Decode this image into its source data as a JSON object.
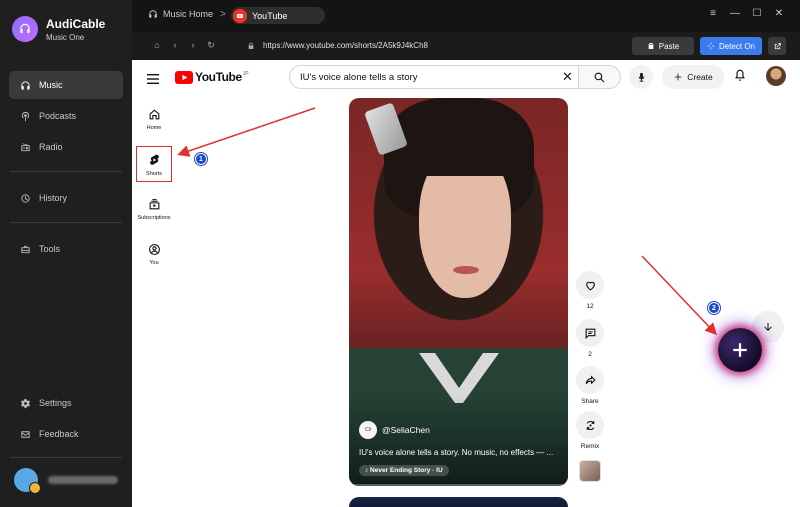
{
  "app": {
    "name": "AudiCable",
    "subtitle": "Music One"
  },
  "sidebar": {
    "items": [
      {
        "label": "Music",
        "icon": "headphones-icon",
        "active": true
      },
      {
        "label": "Podcasts",
        "icon": "podcast-icon",
        "active": false
      },
      {
        "label": "Radio",
        "icon": "radio-icon",
        "active": false
      },
      {
        "label": "History",
        "icon": "history-icon",
        "active": false
      },
      {
        "label": "Tools",
        "icon": "toolbox-icon",
        "active": false
      },
      {
        "label": "Settings",
        "icon": "gear-icon",
        "active": false
      },
      {
        "label": "Feedback",
        "icon": "mail-icon",
        "active": false
      }
    ]
  },
  "topbar": {
    "home_label": "Music Home",
    "separator": ">",
    "tab_label": "YouTube",
    "window_buttons": [
      "≡",
      "—",
      "☐",
      "✕"
    ]
  },
  "addressbar": {
    "url": "https://www.youtube.com/shorts/2A5k9J4kCh8",
    "paste_label": "Paste",
    "detect_label": "Detect On"
  },
  "youtube": {
    "logo_text": "YouTube",
    "search_value": "IU's voice alone tells a story",
    "create_label": "Create",
    "guide": [
      {
        "label": "Home",
        "icon": "home-icon"
      },
      {
        "label": "Shorts",
        "icon": "shorts-icon"
      },
      {
        "label": "Subscriptions",
        "icon": "subscriptions-icon"
      },
      {
        "label": "You",
        "icon": "user-icon"
      }
    ],
    "short": {
      "channel": "@SeliaChen",
      "channel_avatar_text": "Cli",
      "caption": "IU's voice alone tells a story. No music, no effects — ...",
      "sound": "♪ Never Ending Story · IU",
      "progress": 0.02
    },
    "actions": [
      {
        "label": "12",
        "icon": "like-icon"
      },
      {
        "label": "2",
        "icon": "comment-icon"
      },
      {
        "label": "Share",
        "icon": "share-icon"
      },
      {
        "label": "Remix",
        "icon": "remix-icon"
      }
    ]
  },
  "annotations": {
    "badge_1": "1",
    "badge_2": "2"
  },
  "colors": {
    "accent": "#3b7bf0",
    "youtube_red": "#ff0000",
    "annotation_red": "#e03030",
    "badge_blue": "#1c49c9"
  }
}
